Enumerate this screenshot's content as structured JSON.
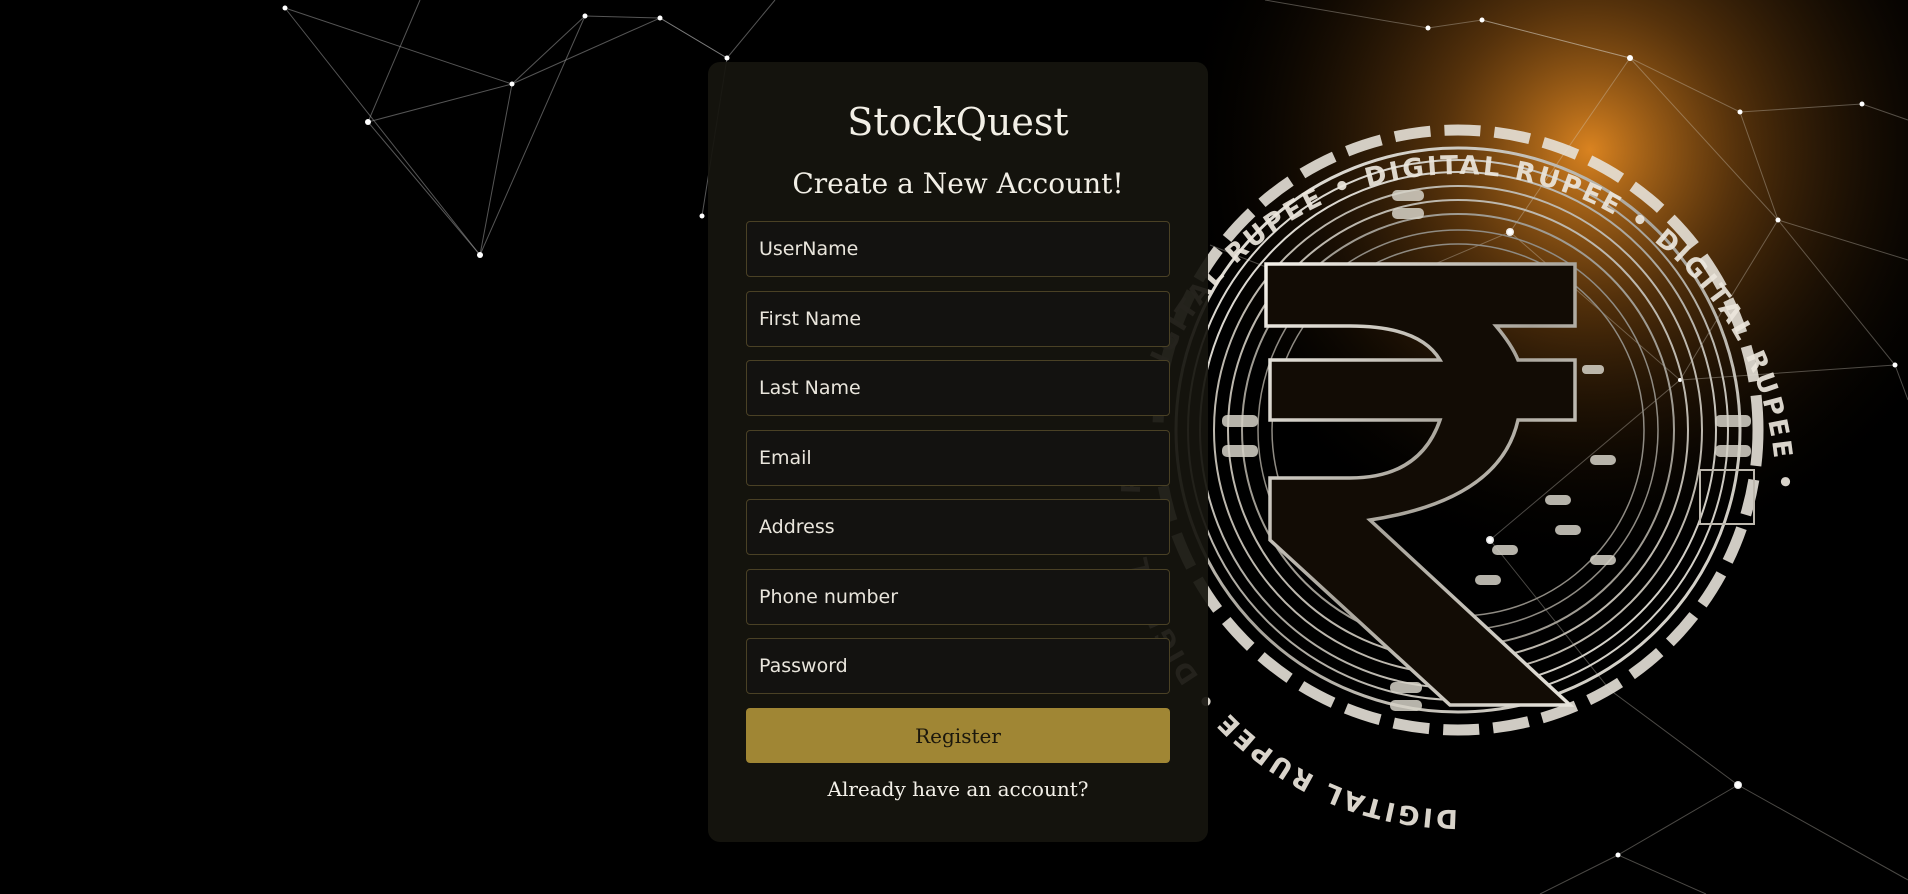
{
  "app": {
    "brand": "StockQuest",
    "subtitle": "Create a New Account!"
  },
  "form": {
    "username_placeholder": "UserName",
    "first_name_placeholder": "First Name",
    "last_name_placeholder": "Last Name",
    "email_placeholder": "Email",
    "address_placeholder": "Address",
    "phone_placeholder": "Phone number",
    "password_placeholder": "Password",
    "register_label": "Register",
    "login_link_label": "Already have an account?"
  },
  "background": {
    "ring_text": "DIGITAL RUPEE",
    "symbol": "₹",
    "accent_color": "#e0821a",
    "button_color": "#a08634"
  }
}
